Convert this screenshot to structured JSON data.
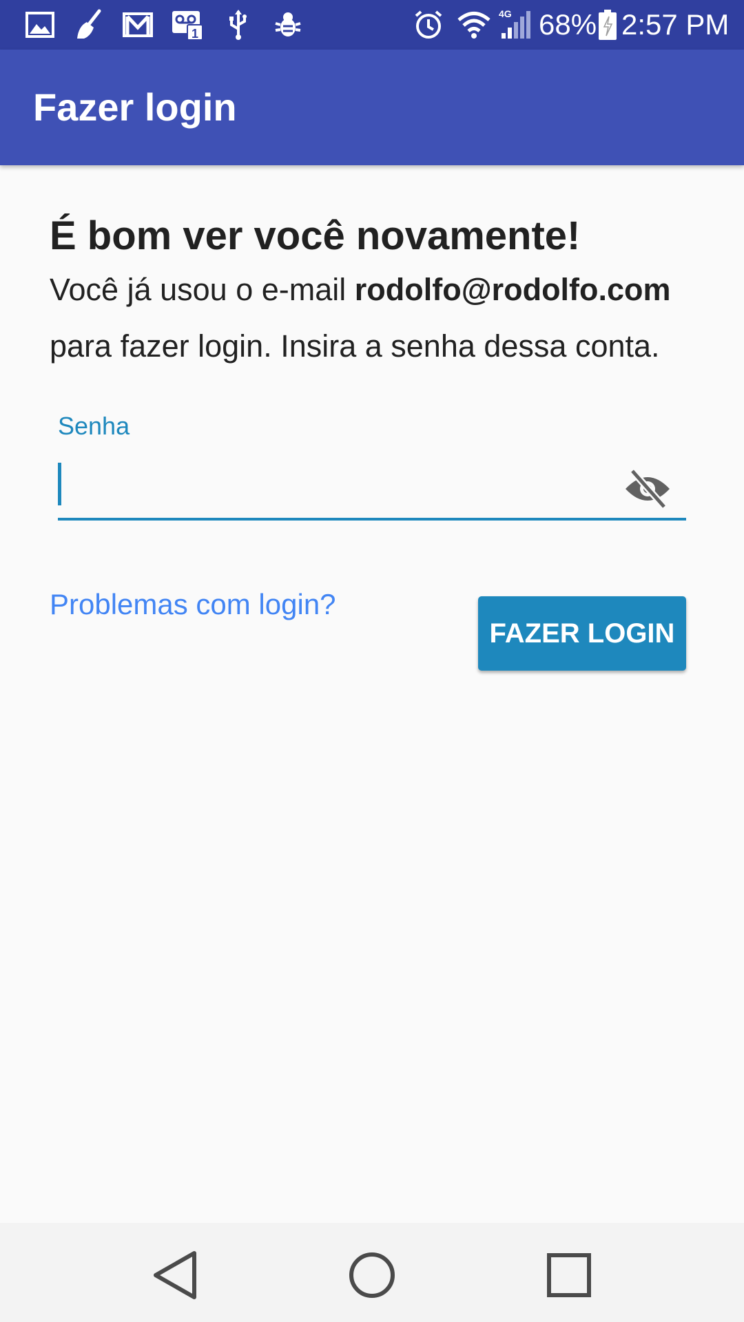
{
  "status_bar": {
    "battery_percent": "68%",
    "network_type": "4G",
    "time": "2:57 PM",
    "icons": [
      "image-icon",
      "broom-icon",
      "gmail-icon",
      "voicemail-icon",
      "usb-icon",
      "bug-icon",
      "alarm-icon",
      "wifi-icon",
      "signal-icon",
      "battery-icon"
    ]
  },
  "app_bar": {
    "title": "Fazer login"
  },
  "content": {
    "heading": "É bom ver você novamente!",
    "body_prefix": "Você já usou o e-mail ",
    "email": "rodolfo@rodolfo.com",
    "body_suffix": " para fazer login. Insira a senha dessa conta.",
    "password_label": "Senha",
    "password_value": "",
    "password_toggle_icon": "eye-off-icon",
    "trouble_link": "Problemas com login?",
    "login_button": "FAZER LOGIN"
  },
  "nav_bar": {
    "icons": [
      "back-icon",
      "home-icon",
      "recents-icon"
    ]
  },
  "colors": {
    "status_bar": "#303f9f",
    "app_bar": "#3f51b5",
    "accent": "#1e88bd",
    "link": "#4285f4",
    "background": "#fafafa",
    "nav_bar": "#f3f3f3"
  }
}
